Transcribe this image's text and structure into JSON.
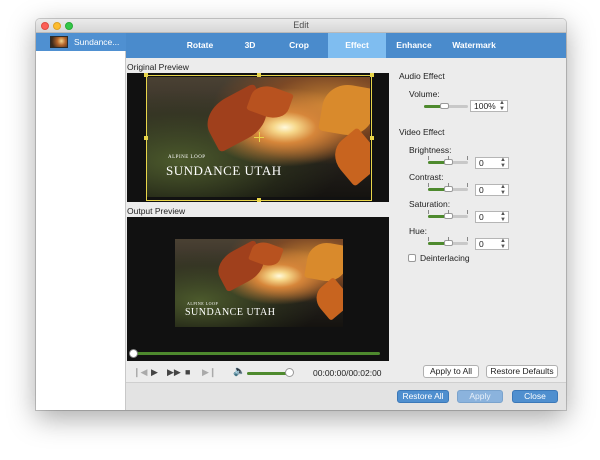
{
  "window": {
    "title": "Edit"
  },
  "sidebar": {
    "items": [
      {
        "label": "Sundance..."
      }
    ]
  },
  "tabs": [
    {
      "label": "Rotate",
      "active": false
    },
    {
      "label": "3D",
      "active": false
    },
    {
      "label": "Crop",
      "active": false
    },
    {
      "label": "Effect",
      "active": true
    },
    {
      "label": "Enhance",
      "active": false
    },
    {
      "label": "Watermark",
      "active": false
    }
  ],
  "preview": {
    "original_label": "Original Preview",
    "output_label": "Output Preview",
    "video_subtitle": "ALPINE LOOP",
    "video_title": "SUNDANCE UTAH"
  },
  "player": {
    "progress": 0,
    "volume": 0.9,
    "timecode": "00:00:00/00:02:00"
  },
  "audio_effect": {
    "title": "Audio Effect",
    "volume_label": "Volume:",
    "volume_value": "100%",
    "volume_level": 0.5
  },
  "video_effect": {
    "title": "Video Effect",
    "brightness_label": "Brightness:",
    "brightness_value": "0",
    "contrast_label": "Contrast:",
    "contrast_value": "0",
    "saturation_label": "Saturation:",
    "saturation_value": "0",
    "hue_label": "Hue:",
    "hue_value": "0",
    "deinterlacing_label": "Deinterlacing",
    "deinterlacing_checked": false
  },
  "buttons": {
    "apply_to_all": "Apply to All",
    "restore_defaults": "Restore Defaults",
    "restore_all": "Restore All",
    "apply": "Apply",
    "close": "Close"
  },
  "colors": {
    "accent": "#4a8bcc",
    "active_tab": "#7fbdf0",
    "slider_green": "#4e8a2e",
    "crop_frame": "#e8d54a"
  }
}
